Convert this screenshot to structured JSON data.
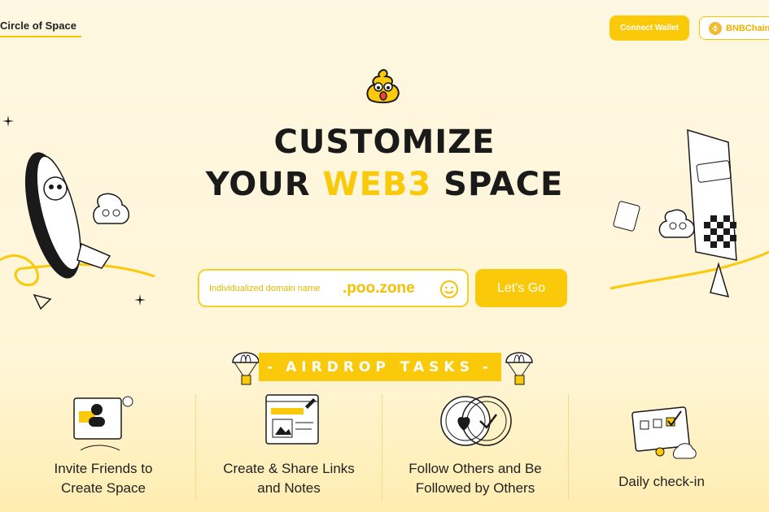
{
  "header": {
    "brand": "Circle of Space",
    "connect_wallet": "Connect Wallet",
    "chain": "BNBChain"
  },
  "hero": {
    "line1": "CUSTOMIZE",
    "line2_pre": "YOUR ",
    "line2_accent": "WEB3",
    "line2_post": " SPACE"
  },
  "domain": {
    "placeholder": "Individualized domain name",
    "suffix": ".poo.zone",
    "button": "Let's Go"
  },
  "airdrop": {
    "title": "AIRDROP TASKS",
    "banner_dashes_left": "-",
    "banner_dashes_right": "-"
  },
  "tasks": [
    {
      "label_line1": "Invite Friends to",
      "label_line2": "Create Space",
      "icon": "invite-icon"
    },
    {
      "label_line1": "Create & Share Links",
      "label_line2": "and Notes",
      "icon": "create-share-icon"
    },
    {
      "label_line1": "Follow Others and Be",
      "label_line2": "Followed by Others",
      "icon": "follow-icon"
    },
    {
      "label_line1": "Daily check-in",
      "label_line2": "",
      "icon": "checkin-icon"
    }
  ],
  "colors": {
    "accent": "#fac90a",
    "background": "#fef7e1",
    "text": "#1a1a1a"
  }
}
